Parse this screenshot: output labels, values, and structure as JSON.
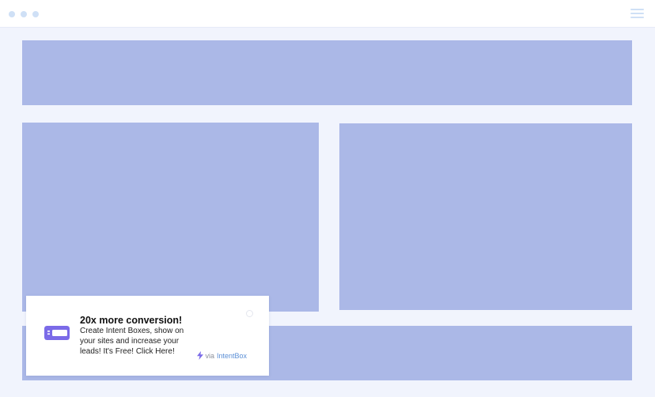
{
  "browser": {
    "dots": [
      "window-dot-1",
      "window-dot-2",
      "window-dot-3"
    ],
    "menu_icon": "hamburger-menu-icon"
  },
  "placeholders": [
    "hero-banner",
    "left-panel",
    "right-panel",
    "footer-banner"
  ],
  "notification": {
    "icon": "credit-card-icon",
    "title": "20x more conversion!",
    "body": "Create Intent Boxes, show on your sites and increase your leads! It's Free! Click Here!",
    "via_label": "via",
    "brand": "IntentBox",
    "brand_icon": "lightning-bolt-icon"
  },
  "colors": {
    "placeholder": "#abb8e7",
    "background": "#f1f4fd",
    "accent": "#7b6be8",
    "brand_link": "#5b8fd6"
  }
}
